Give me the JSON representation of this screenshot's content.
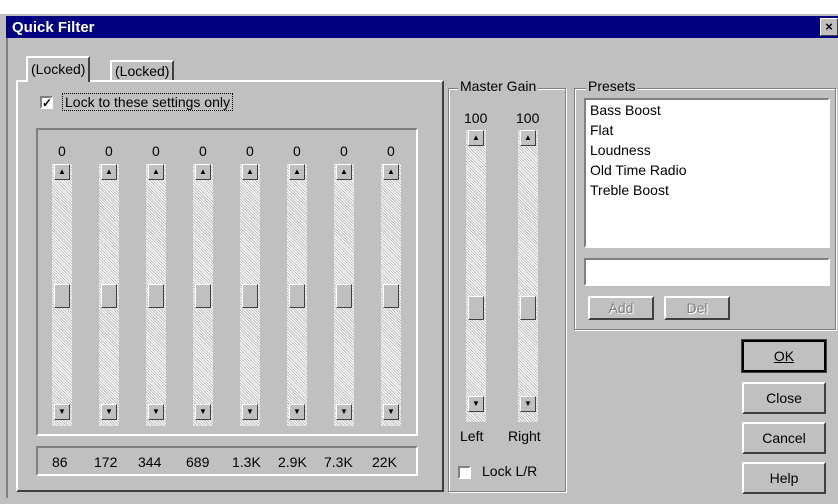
{
  "window": {
    "title": "Quick Filter",
    "close_glyph": "×"
  },
  "tabs": [
    "(Locked)",
    "(Locked)"
  ],
  "lock_settings": {
    "label": "Lock to these settings only",
    "checked": true
  },
  "eq": {
    "values": [
      "0",
      "0",
      "0",
      "0",
      "0",
      "0",
      "0",
      "0"
    ],
    "frequencies": [
      "86",
      "172",
      "344",
      "689",
      "1.3K",
      "2.9K",
      "7.3K",
      "22K"
    ]
  },
  "master_gain": {
    "title": "Master Gain",
    "left_value": "100",
    "right_value": "100",
    "left_label": "Left",
    "right_label": "Right",
    "lock_lr_label": "Lock L/R",
    "lock_lr_checked": false
  },
  "presets": {
    "title": "Presets",
    "items": [
      "Bass Boost",
      "Flat",
      "Loudness",
      "Old Time Radio",
      "Treble Boost"
    ],
    "input_value": "",
    "add_label": "Add",
    "del_label": "Del"
  },
  "buttons": {
    "ok": "OK",
    "close": "Close",
    "cancel": "Cancel",
    "help": "Help"
  },
  "icons": {
    "up": "▲",
    "down": "▼",
    "check": "✓"
  }
}
